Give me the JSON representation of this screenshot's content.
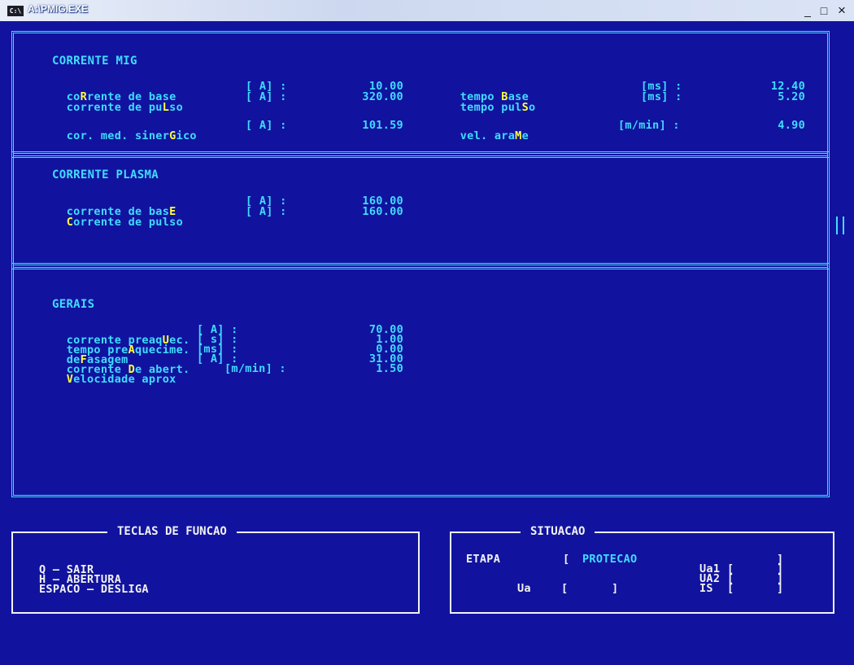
{
  "window": {
    "icon_label": "C:\\",
    "title": "A:\\PMIG.EXE",
    "minimize_glyph": "_",
    "maximize_glyph": "□",
    "close_glyph": "×"
  },
  "mig": {
    "heading": "CORRENTE MIG",
    "row1": {
      "pre": "co",
      "hot": "R",
      "post": "rente de base",
      "unit": "[ A] :",
      "value": "10.00",
      "r_pre": "tempo ",
      "r_hot": "B",
      "r_post": "ase",
      "r_unit": "[ms] :",
      "r_value": "12.40"
    },
    "row2": {
      "pre": "corrente de pu",
      "hot": "L",
      "post": "so",
      "unit": "[ A] :",
      "value": "320.00",
      "r_pre": "tempo pul",
      "r_hot": "S",
      "r_post": "o",
      "r_unit": "[ms] :",
      "r_value": "5.20"
    },
    "row3": {
      "pre": "cor. med. siner",
      "hot": "G",
      "post": "ico",
      "unit": "[ A] :",
      "value": "101.59",
      "r_pre": "vel. ara",
      "r_hot": "M",
      "r_post": "e",
      "r_unit": "[m/min] :",
      "r_value": "4.90"
    }
  },
  "plasma": {
    "heading": "CORRENTE PLASMA",
    "row1": {
      "pre": "corrente de bas",
      "hot": "E",
      "post": "",
      "unit": "[ A] :",
      "value": "160.00"
    },
    "row2": {
      "pre": "",
      "hot": "C",
      "post": "orrente de pulso",
      "unit": "[ A] :",
      "value": "160.00"
    }
  },
  "gerais": {
    "heading": "GERAIS",
    "row1": {
      "pre": "corrente preaq",
      "hot": "U",
      "post": "ec.",
      "unit": "[ A] :",
      "value": "70.00"
    },
    "row2": {
      "pre": "tempo pre",
      "hot": "A",
      "post": "quecime.",
      "unit": "[ s] :",
      "value": "1.00"
    },
    "row3": {
      "pre": "de",
      "hot": "F",
      "post": "asagem",
      "unit": "[ms] :",
      "value": "0.00"
    },
    "row4": {
      "pre": "corrente ",
      "hot": "D",
      "post": "e abert.",
      "unit": "[ A] :",
      "value": "31.00"
    },
    "row5": {
      "pre": "",
      "hot": "V",
      "post": "elocidade aprox",
      "unit": "[m/min] :",
      "value": "1.50"
    }
  },
  "keys": {
    "title": "TECLAS DE FUNCAO",
    "items": [
      "Q — SAIR",
      "H — ABERTURA",
      "ESPACO — DESLIGA"
    ]
  },
  "situacao": {
    "title": "SITUACAO",
    "etapa_label": "ETAPA",
    "etapa_open": "[",
    "etapa_value": "PROTECAO",
    "va1_label": "Ua1",
    "va2_label": "UA2",
    "va_label": "Ua",
    "is_label": "IS",
    "bracket_open": "[",
    "bracket_close": "]"
  },
  "colors": {
    "background": "#11139f",
    "cyan": "#40dcfc",
    "white": "#f2f2f2",
    "yellow": "#ffff40"
  }
}
